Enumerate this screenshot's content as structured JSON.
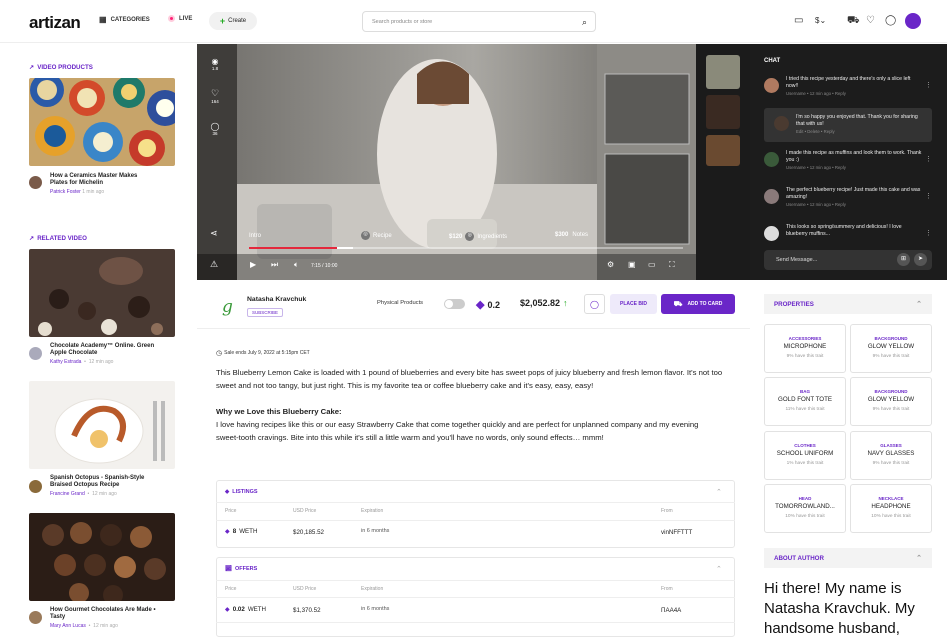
{
  "header": {
    "logo": "artizan",
    "categories": "CATEGORIES",
    "live": "LIVE",
    "create": "Create",
    "search_placeholder": "Search products or store"
  },
  "sidebar": {
    "video_products_label": "VIDEO PRODUCTS",
    "related_video_label": "RELATED VIDEO",
    "video_products": [
      {
        "title": "How a Ceramics Master Makes Plates for Michelin",
        "author": "Patrick Foster",
        "time": "1 min ago"
      }
    ],
    "related": [
      {
        "title": "Chocolate Academy™ Online. Green Apple Chocolate",
        "author": "Kathy Estrada",
        "time": "12 min ago"
      },
      {
        "title": "Spanish Octopus - Spanish-Style Braised Octopus Recipe",
        "author": "Francine Grand",
        "time": "12 min ago"
      },
      {
        "title": "How Gourmet Chocolates Are Made • Tasty",
        "author": "Mary Ann Lucas",
        "time": "12 min ago"
      }
    ]
  },
  "video": {
    "views": "1.8",
    "likes": "164",
    "comments": "36",
    "chapters": [
      {
        "label": "Intro"
      },
      {
        "label": "Recipe"
      },
      {
        "price": "$120",
        "label": "Ingredients"
      },
      {
        "price": "$300",
        "label": "Notes"
      }
    ],
    "time": "7:15 / 10:00"
  },
  "chat": {
    "title": "CHAT",
    "messages": [
      {
        "text": "I tried this recipe yesterday and there's only a slice left now!!",
        "meta": "Username • 12 min ago • Reply"
      },
      {
        "text": "I'm so happy you enjoyed that. Thank you for sharing that with us!",
        "meta": "Edit • Delete • Reply"
      },
      {
        "text": "I made this recipe as muffins and look them to work. Thank you :)",
        "meta": "Username • 12 min ago • Reply"
      },
      {
        "text": "The perfect blueberry recipe! Just made this cake and was amazing!",
        "meta": "Username • 12 min ago • Reply"
      },
      {
        "text": "This looks so spring/summery and delicious! I love blueberry muffins...",
        "meta": ""
      }
    ],
    "input_placeholder": "Send Message..."
  },
  "product": {
    "seller": "Natasha Kravchuk",
    "subscribe": "SUBSCRIBE",
    "physical": "Physical Products",
    "eth": "0.2",
    "price": "$2,052.82",
    "place_bid": "PLACE BID",
    "add_to_card": "ADD TO CARD",
    "sale_ends": "Sale ends July 9, 2022 at 5:15pm CET",
    "desc1": "This Blueberry Lemon Cake is loaded with 1 pound of blueberries and every bite has sweet pops of juicy blueberry and fresh lemon flavor. It's not too sweet and not too tangy, but just right. This is my favorite tea or coffee blueberry cake and it's easy, easy, easy!",
    "why_title": "Why we Love this Blueberry Cake:",
    "desc2": "I love having recipes like this or our easy Strawberry Cake that come together quickly and are perfect for unplanned company and my evening sweet-tooth cravings. Bite into this while it's still a little warm and you'll have no words, only sound effects… mmm!"
  },
  "listings": {
    "title": "LISTINGS",
    "headers": [
      "Price",
      "USD Price",
      "Expiration",
      "From"
    ],
    "row": {
      "price": "8",
      "unit": "WETH",
      "usd": "$20,185.52",
      "exp": "in 6 months",
      "from": "vinNFFTTT"
    }
  },
  "offers": {
    "title": "OFFERS",
    "headers": [
      "Price",
      "USD Price",
      "Expiration",
      "From"
    ],
    "row": {
      "price": "0.02",
      "unit": "WETH",
      "usd": "$1,370.52",
      "exp": "in 6 months",
      "from": "ПAA4A"
    }
  },
  "properties": {
    "title": "PROPERTIES",
    "items": [
      {
        "type": "ACCESSORIES",
        "value": "MICROPHONE",
        "rarity": "9% have this trait"
      },
      {
        "type": "BACKGROUND",
        "value": "GLOW YELLOW",
        "rarity": "9% have this trait"
      },
      {
        "type": "BAG",
        "value": "GOLD FONT TOTE",
        "rarity": "11% have this trait"
      },
      {
        "type": "BACKGROUND",
        "value": "GLOW YELLOW",
        "rarity": "9% have this trait"
      },
      {
        "type": "CLOTHES",
        "value": "SCHOOL UNIFORM",
        "rarity": "1% have this trait"
      },
      {
        "type": "GLASSES",
        "value": "NAVY GLASSES",
        "rarity": "9% have this trait"
      },
      {
        "type": "HEAD",
        "value": "TOMORROWLAND...",
        "rarity": "10% have this trait"
      },
      {
        "type": "NECKLACE",
        "value": "HEADPHONE",
        "rarity": "10% have this trait"
      }
    ]
  },
  "about": {
    "title": "ABOUT AUTHOR",
    "text": "Hi there! My name is Natasha Kravchuk. My handsome husband,"
  },
  "colors": {
    "accent": "#6a26c8",
    "progress": "#e4283c"
  }
}
